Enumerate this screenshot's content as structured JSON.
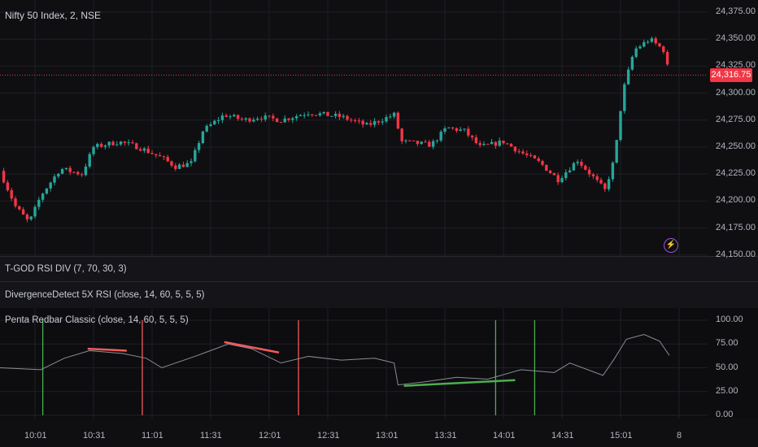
{
  "header": {
    "symbol_title": "Nifty 50 Index, 2, NSE"
  },
  "price_axis": {
    "labels": [
      "24,375.00",
      "24,350.00",
      "24,325.00",
      "24,300.00",
      "24,275.00",
      "24,250.00",
      "24,225.00",
      "24,200.00",
      "24,175.00",
      "24,150.00"
    ],
    "current_price": "24,316.75",
    "current_value": 24316.75
  },
  "indicators": [
    {
      "label": "T-GOD RSI DIV (7, 70, 30, 3)"
    },
    {
      "label": "DivergenceDetect 5X RSI (close, 14, 60, 5, 5, 5)"
    },
    {
      "label": "Penta Redbar Classic (close, 14, 60, 5, 5, 5)",
      "scale": [
        "100.00",
        "75.00",
        "50.00",
        "25.00",
        "0.00"
      ]
    }
  ],
  "time_axis": [
    "10:01",
    "10:31",
    "11:01",
    "11:31",
    "12:01",
    "12:31",
    "13:01",
    "13:31",
    "14:01",
    "14:31",
    "15:01",
    "8"
  ],
  "colors": {
    "up": "#26a69a",
    "down": "#f23645",
    "rsi": "#8a8d95",
    "bull": "#4caf50",
    "bear": "#f25a5a"
  },
  "chart_data": {
    "type": "candlestick",
    "title": "Nifty 50 Index, 2, NSE",
    "ylim": [
      24150,
      24375
    ],
    "x_unit": "minutes since 10:01",
    "close_path": [
      [
        -18,
        24228
      ],
      [
        -10,
        24195
      ],
      [
        -3,
        24180
      ],
      [
        3,
        24205
      ],
      [
        13,
        24230
      ],
      [
        24,
        24225
      ],
      [
        30,
        24250
      ],
      [
        43,
        24255
      ],
      [
        53,
        24250
      ],
      [
        65,
        24240
      ],
      [
        72,
        24232
      ],
      [
        80,
        24235
      ],
      [
        86,
        24265
      ],
      [
        97,
        24280
      ],
      [
        107,
        24275
      ],
      [
        115,
        24278
      ],
      [
        126,
        24275
      ],
      [
        140,
        24282
      ],
      [
        157,
        24278
      ],
      [
        170,
        24270
      ],
      [
        184,
        24280
      ],
      [
        188,
        24255
      ],
      [
        203,
        24252
      ],
      [
        211,
        24268
      ],
      [
        220,
        24265
      ],
      [
        228,
        24250
      ],
      [
        240,
        24255
      ],
      [
        249,
        24245
      ],
      [
        259,
        24235
      ],
      [
        268,
        24220
      ],
      [
        278,
        24238
      ],
      [
        286,
        24222
      ],
      [
        292,
        24210
      ],
      [
        297,
        24240
      ],
      [
        301,
        24300
      ],
      [
        307,
        24340
      ],
      [
        315,
        24350
      ],
      [
        322,
        24340
      ],
      [
        325,
        24317
      ]
    ],
    "rsi": {
      "ylim": [
        0,
        100
      ],
      "path": [
        [
          -18,
          50
        ],
        [
          3,
          48
        ],
        [
          15,
          60
        ],
        [
          28,
          68
        ],
        [
          45,
          65
        ],
        [
          57,
          60
        ],
        [
          65,
          50
        ],
        [
          82,
          62
        ],
        [
          99,
          75
        ],
        [
          111,
          70
        ],
        [
          126,
          55
        ],
        [
          140,
          62
        ],
        [
          157,
          58
        ],
        [
          174,
          60
        ],
        [
          184,
          55
        ],
        [
          186,
          32
        ],
        [
          199,
          35
        ],
        [
          216,
          40
        ],
        [
          232,
          38
        ],
        [
          249,
          48
        ],
        [
          266,
          45
        ],
        [
          274,
          55
        ],
        [
          291,
          42
        ],
        [
          297,
          60
        ],
        [
          303,
          80
        ],
        [
          312,
          85
        ],
        [
          320,
          78
        ],
        [
          325,
          63
        ]
      ],
      "bear_divergences": [
        [
          [
            27,
            70
          ],
          [
            47,
            68
          ]
        ],
        [
          [
            97,
            77
          ],
          [
            125,
            66
          ]
        ]
      ],
      "bull_divergences": [
        [
          [
            189,
            31
          ],
          [
            246,
            37
          ]
        ]
      ],
      "signals": [
        {
          "t": 4,
          "type": "bull"
        },
        {
          "t": 55,
          "type": "bear"
        },
        {
          "t": 135,
          "type": "bear"
        },
        {
          "t": 236,
          "type": "bull"
        },
        {
          "t": 256,
          "type": "bull"
        }
      ]
    }
  }
}
